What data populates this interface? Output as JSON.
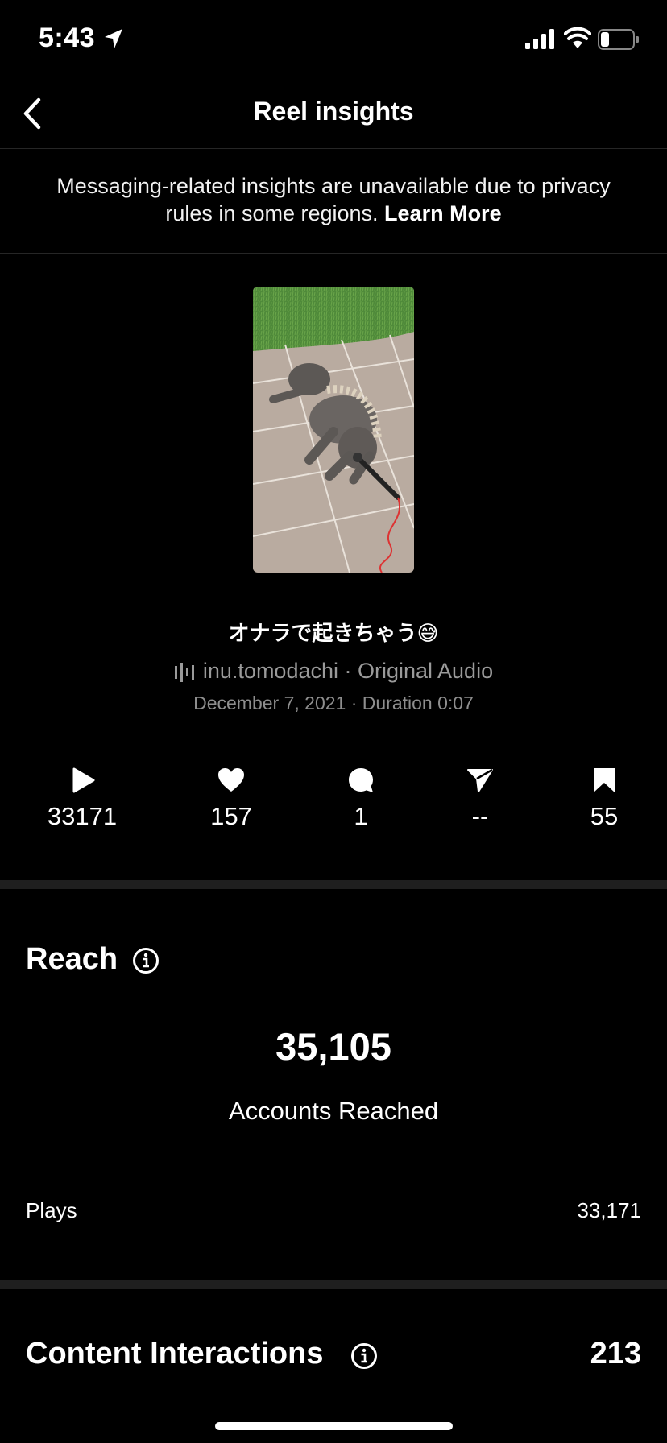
{
  "status_bar": {
    "time": "5:43"
  },
  "nav": {
    "title": "Reel insights"
  },
  "notice": {
    "text": "Messaging-related insights are unavailable due to privacy rules in some regions.",
    "link": "Learn More"
  },
  "reel": {
    "caption": "オナラで起きちゃう😅",
    "audio": "inu.tomodachi · Original Audio",
    "meta": "December 7, 2021 · Duration 0:07"
  },
  "metrics": [
    {
      "icon": "play-icon",
      "value": "33171"
    },
    {
      "icon": "heart-icon",
      "value": "157"
    },
    {
      "icon": "comment-icon",
      "value": "1"
    },
    {
      "icon": "share-icon",
      "value": "--"
    },
    {
      "icon": "bookmark-icon",
      "value": "55"
    }
  ],
  "reach": {
    "title": "Reach",
    "accounts_reached": "35,105",
    "accounts_label": "Accounts Reached",
    "plays_label": "Plays",
    "plays_value": "33,171"
  },
  "content_interactions": {
    "title": "Content Interactions",
    "value": "213"
  }
}
